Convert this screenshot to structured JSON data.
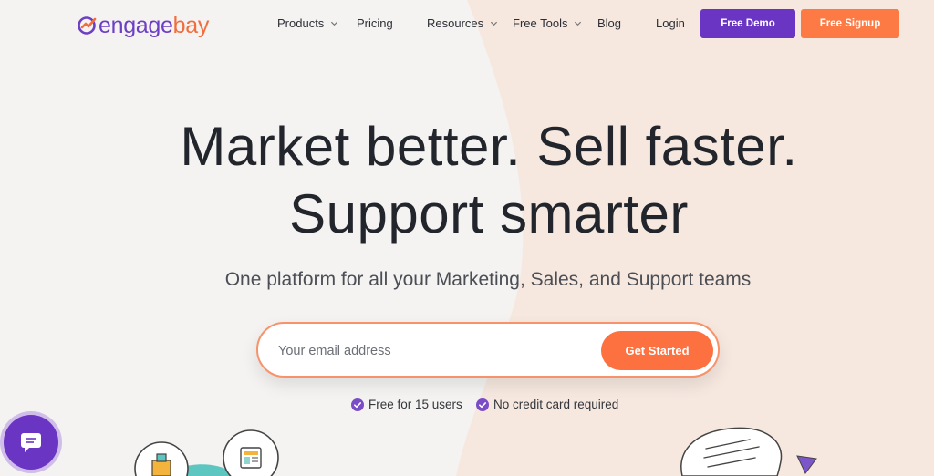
{
  "brand": {
    "name_part1": "engage",
    "name_part2": "bay"
  },
  "nav": {
    "items": [
      {
        "label": "Products",
        "has_dropdown": true
      },
      {
        "label": "Pricing",
        "has_dropdown": false
      },
      {
        "label": "Resources",
        "has_dropdown": true
      },
      {
        "label": "Free Tools",
        "has_dropdown": true
      },
      {
        "label": "Blog",
        "has_dropdown": false
      },
      {
        "label": "Login",
        "has_dropdown": false
      }
    ],
    "demo_button": "Free Demo",
    "signup_button": "Free Signup"
  },
  "hero": {
    "title_line1": "Market better. Sell faster.",
    "title_line2": "Support smarter",
    "subtitle": "One platform for all your Marketing, Sales, and Support teams",
    "email_placeholder": "Your email address",
    "email_value": "",
    "cta_label": "Get Started",
    "perks": [
      "Free for 15 users",
      "No credit card required"
    ]
  },
  "colors": {
    "purple": "#6a35c2",
    "orange": "#fd7a45",
    "background": "#f4f3f1",
    "peach": "#f6e8df"
  },
  "icons": [
    "chevron-down-icon",
    "check-circle-icon",
    "chat-icon"
  ]
}
